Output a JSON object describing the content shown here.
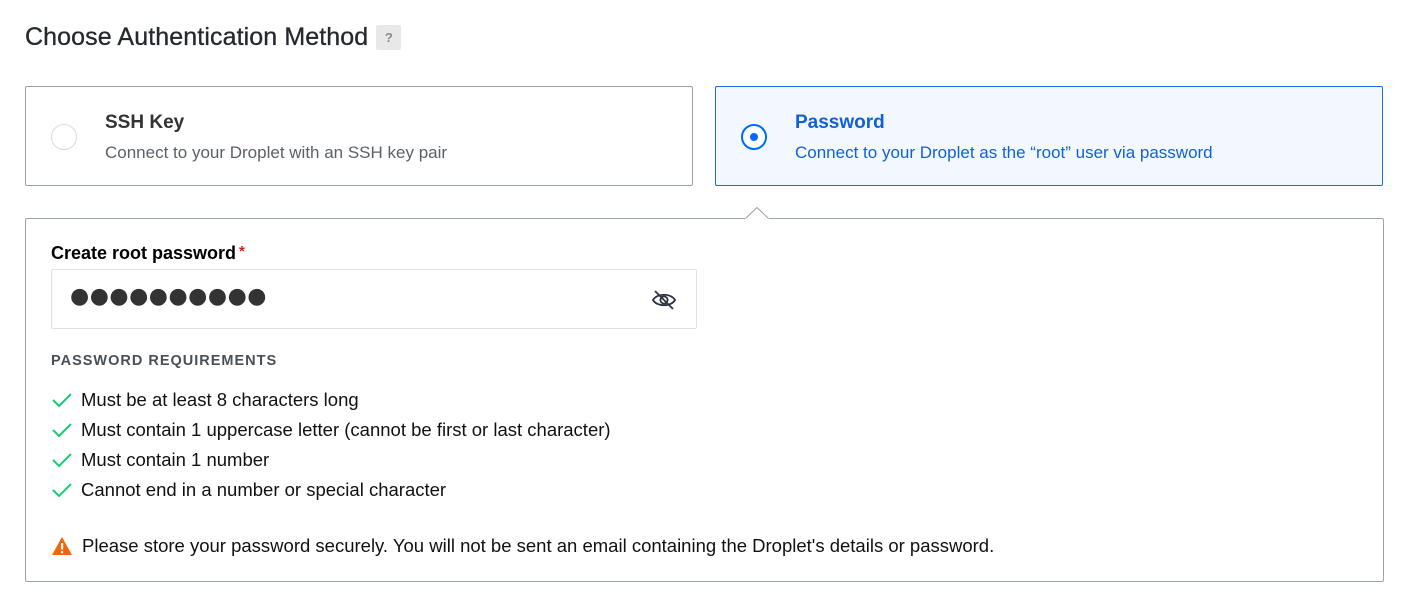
{
  "section": {
    "title": "Choose Authentication Method",
    "help_label": "?"
  },
  "options": [
    {
      "title": "SSH Key",
      "description": "Connect to your Droplet with an SSH key pair",
      "selected": false
    },
    {
      "title": "Password",
      "description": "Connect to your Droplet as the “root” user via password",
      "selected": true
    }
  ],
  "password_panel": {
    "label": "Create root password",
    "required_mark": "*",
    "value": "●●●●●●●●●●",
    "toggle_icon": "eye-slash-icon",
    "requirements_heading": "PASSWORD REQUIREMENTS",
    "requirements": [
      "Must be at least 8 characters long",
      "Must contain 1 uppercase letter (cannot be first or last character)",
      "Must contain 1 number",
      "Cannot end in a number or special character"
    ],
    "warning": "Please store your password securely. You will not be sent an email containing the Droplet's details or password."
  },
  "colors": {
    "accent": "#0069ff",
    "selected_bg": "#f3f8ff",
    "check": "#15cd72",
    "warning": "#f5640a",
    "required": "#d9161b"
  }
}
